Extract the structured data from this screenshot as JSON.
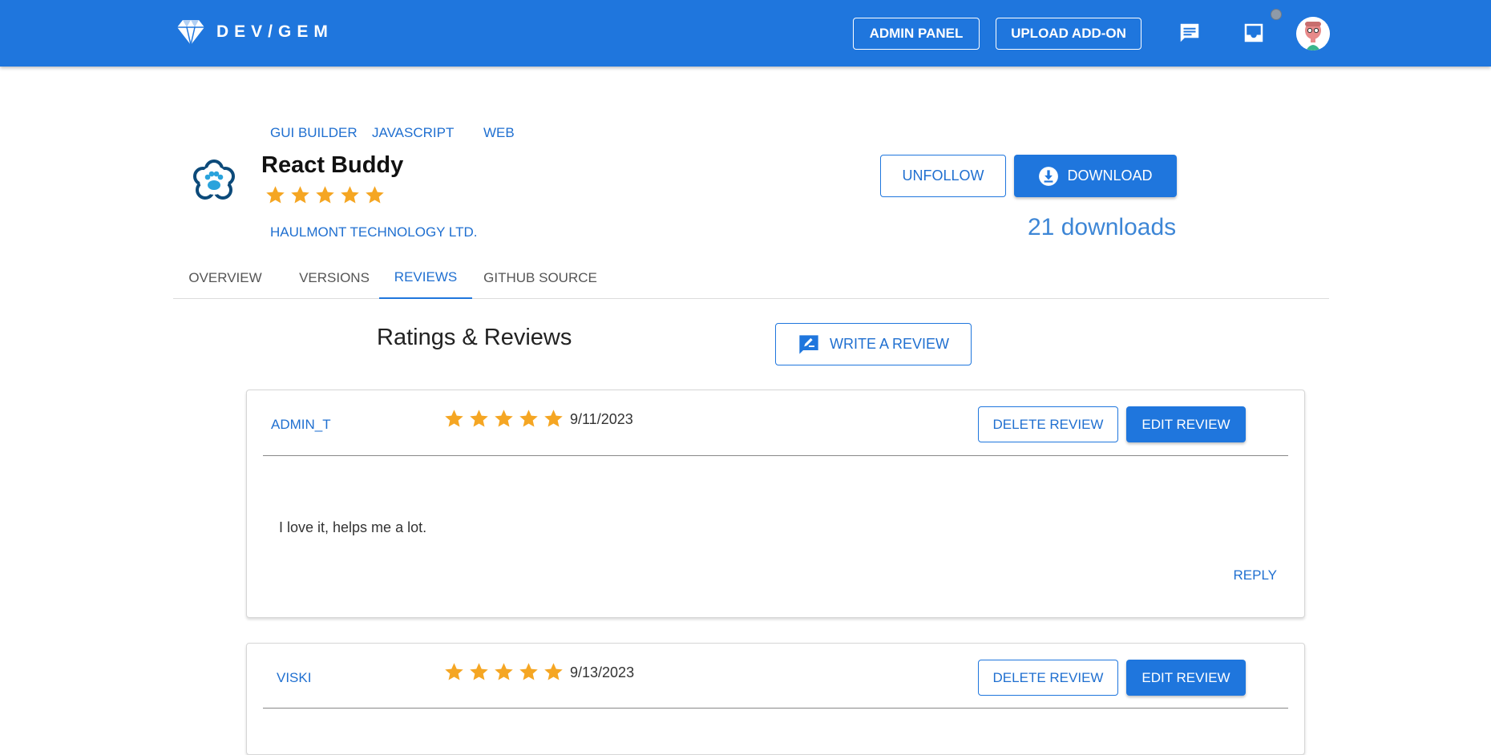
{
  "topbar": {
    "logo_text": "DEV/GEM",
    "admin_panel": "ADMIN PANEL",
    "upload_addon": "UPLOAD ADD-ON",
    "icons": [
      "gem-logo-icon",
      "chat-icon",
      "inbox-icon",
      "avatar"
    ],
    "color": "#1f76dd"
  },
  "addon": {
    "tags": [
      "GUI BUILDER",
      "JAVASCRIPT",
      "WEB"
    ],
    "title": "React Buddy",
    "rating": 5,
    "vendor": "HAULMONT TECHNOLOGY LTD.",
    "unfollow_label": "UNFOLLOW",
    "download_label": "DOWNLOAD",
    "downloads_text": "21 downloads"
  },
  "tabs": [
    {
      "label": "OVERVIEW",
      "active": false
    },
    {
      "label": "VERSIONS",
      "active": false
    },
    {
      "label": "REVIEWS",
      "active": true
    },
    {
      "label": "GITHUB SOURCE",
      "active": false
    }
  ],
  "reviews_section": {
    "title": "Ratings & Reviews",
    "write_review_label": "WRITE A REVIEW"
  },
  "reviews": [
    {
      "user": "ADMIN_T",
      "rating": 5,
      "date": "9/11/2023",
      "text": "I love it, helps me a lot.",
      "delete_label": "DELETE REVIEW",
      "edit_label": "EDIT REVIEW",
      "reply_label": "REPLY"
    },
    {
      "user": "VISKI",
      "rating": 5,
      "date": "9/13/2023",
      "delete_label": "DELETE REVIEW",
      "edit_label": "EDIT REVIEW"
    }
  ],
  "colors": {
    "primary": "#1f76dd",
    "star": "#f5a623"
  }
}
